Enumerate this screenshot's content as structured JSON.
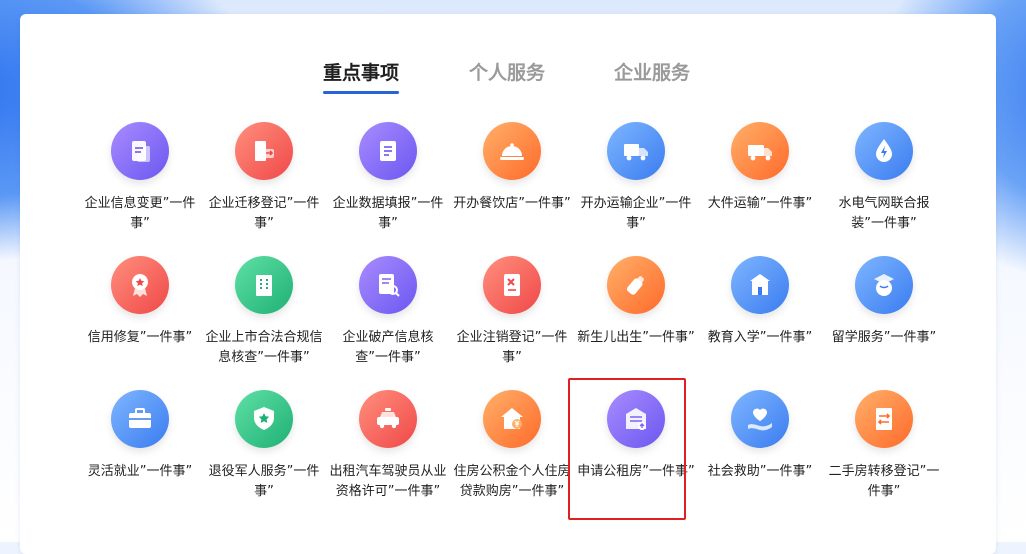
{
  "tabs": [
    {
      "label": "重点事项",
      "active": true
    },
    {
      "label": "个人服务",
      "active": false
    },
    {
      "label": "企业服务",
      "active": false
    }
  ],
  "items": [
    {
      "label": "企业信息变更”一件事”",
      "icon": "document-exchange-icon",
      "color": "purple"
    },
    {
      "label": "企业迁移登记”一件事”",
      "icon": "building-move-icon",
      "color": "red"
    },
    {
      "label": "企业数据填报”一件事”",
      "icon": "form-edit-icon",
      "color": "purple"
    },
    {
      "label": "开办餐饮店”一件事”",
      "icon": "food-cloche-icon",
      "color": "orange"
    },
    {
      "label": "开办运输企业”一件事”",
      "icon": "truck-icon",
      "color": "blue"
    },
    {
      "label": "大件运输”一件事”",
      "icon": "heavy-truck-icon",
      "color": "orange"
    },
    {
      "label": "水电气网联合报装”一件事”",
      "icon": "water-electric-icon",
      "color": "blue"
    },
    {
      "label": "信用修复”一件事”",
      "icon": "credit-badge-icon",
      "color": "red"
    },
    {
      "label": "企业上市合法合规信息核查”一件事”",
      "icon": "office-building-icon",
      "color": "green"
    },
    {
      "label": "企业破产信息核查”一件事”",
      "icon": "document-search-icon",
      "color": "purple"
    },
    {
      "label": "企业注销登记”一件事”",
      "icon": "cancel-document-icon",
      "color": "red"
    },
    {
      "label": "新生儿出生”一件事”",
      "icon": "baby-bottle-icon",
      "color": "orange"
    },
    {
      "label": "教育入学”一件事”",
      "icon": "school-icon",
      "color": "blue"
    },
    {
      "label": "留学服务”一件事”",
      "icon": "graduation-globe-icon",
      "color": "blue"
    },
    {
      "label": "灵活就业”一件事”",
      "icon": "briefcase-icon",
      "color": "blue"
    },
    {
      "label": "退役军人服务”一件事”",
      "icon": "military-badge-icon",
      "color": "green"
    },
    {
      "label": "出租汽车驾驶员从业资格许可”一件事”",
      "icon": "taxi-icon",
      "color": "red"
    },
    {
      "label": "住房公积金个人住房贷款购房”一件事”",
      "icon": "house-yuan-icon",
      "color": "orange"
    },
    {
      "label": "申请公租房”一件事”",
      "icon": "public-housing-icon",
      "color": "purple"
    },
    {
      "label": "社会救助”一件事”",
      "icon": "heart-hand-icon",
      "color": "blue"
    },
    {
      "label": "二手房转移登记”一件事”",
      "icon": "building-transfer-icon",
      "color": "orange"
    }
  ]
}
